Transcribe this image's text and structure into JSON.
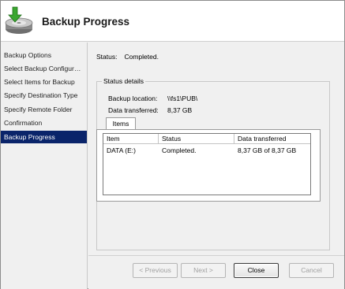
{
  "header": {
    "title": "Backup Progress",
    "icon": "backup-drive-icon"
  },
  "sidebar": {
    "items": [
      {
        "label": "Backup Options",
        "active": false
      },
      {
        "label": "Select Backup Configur…",
        "active": false
      },
      {
        "label": "Select Items for Backup",
        "active": false
      },
      {
        "label": "Specify Destination Type",
        "active": false
      },
      {
        "label": "Specify Remote Folder",
        "active": false
      },
      {
        "label": "Confirmation",
        "active": false
      },
      {
        "label": "Backup Progress",
        "active": true
      }
    ]
  },
  "main": {
    "status_label": "Status:",
    "status_value": "Completed.",
    "details": {
      "legend": "Status details",
      "backup_location_label": "Backup location:",
      "backup_location_value": "\\\\fs1\\PUB\\",
      "data_transferred_label": "Data transferred:",
      "data_transferred_value": "8,37 GB",
      "tab_label": "Items",
      "table": {
        "columns": [
          "Item",
          "Status",
          "Data transferred"
        ],
        "rows": [
          [
            "DATA (E:)",
            "Completed.",
            "8,37 GB of 8,37 GB"
          ]
        ]
      }
    }
  },
  "footer": {
    "previous_label": "< Previous",
    "next_label": "Next >",
    "close_label": "Close",
    "cancel_label": "Cancel"
  },
  "colors": {
    "active_step_bg": "#0a246a",
    "panel_bg": "#f0f0f0",
    "icon_arrow": "#3aa62f"
  }
}
